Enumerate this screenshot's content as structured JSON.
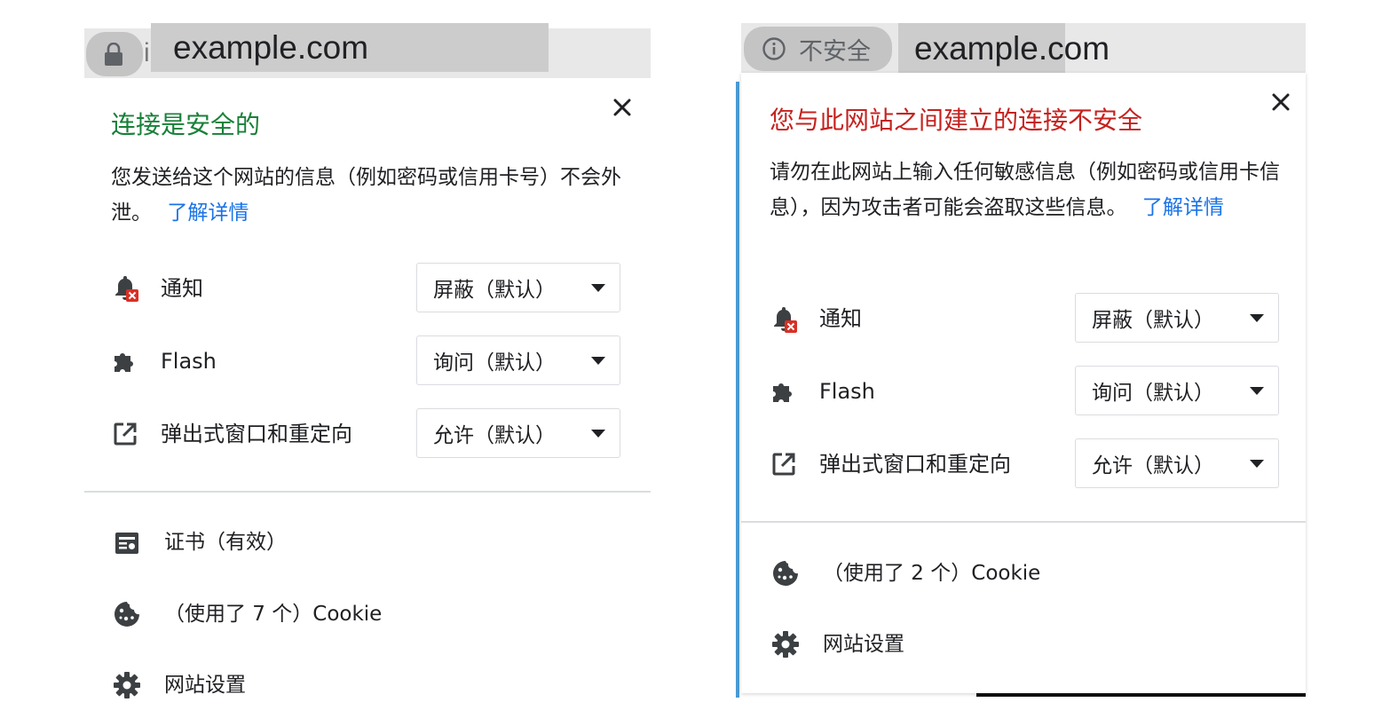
{
  "left": {
    "address_bar": {
      "url": "example.com",
      "partial_text": "i"
    },
    "title": "连接是安全的",
    "title_color": "#188038",
    "description": "您发送给这个网站的信息（例如密码或信用卡号）不会外泄。",
    "learn_more": "了解详情",
    "permissions": [
      {
        "icon": "notification-blocked-icon",
        "label": "通知",
        "value": "屏蔽（默认）"
      },
      {
        "icon": "puzzle-icon",
        "label": "Flash",
        "value": "询问（默认）"
      },
      {
        "icon": "popup-icon",
        "label": "弹出式窗口和重定向",
        "value": "允许（默认）"
      }
    ],
    "items": [
      {
        "icon": "certificate-icon",
        "label": "证书（有效）"
      },
      {
        "icon": "cookie-icon",
        "label": "（使用了 7 个）Cookie"
      },
      {
        "icon": "gear-icon",
        "label": "网站设置"
      }
    ]
  },
  "right": {
    "address_bar": {
      "url": "example.com",
      "security_label": "不安全"
    },
    "title": "您与此网站之间建立的连接不安全",
    "title_color": "#c5221f",
    "description": "请勿在此网站上输入任何敏感信息（例如密码或信用卡信息），因为攻击者可能会盗取这些信息。",
    "learn_more": "了解详情",
    "permissions": [
      {
        "icon": "notification-blocked-icon",
        "label": "通知",
        "value": "屏蔽（默认）"
      },
      {
        "icon": "puzzle-icon",
        "label": "Flash",
        "value": "询问（默认）"
      },
      {
        "icon": "popup-icon",
        "label": "弹出式窗口和重定向",
        "value": "允许（默认）"
      }
    ],
    "items": [
      {
        "icon": "cookie-icon",
        "label": "（使用了 2 个）Cookie"
      },
      {
        "icon": "gear-icon",
        "label": "网站设置"
      }
    ]
  },
  "colors": {
    "link": "#1a73e8",
    "icon": "#5f6368",
    "blocked_badge": "#d93025",
    "panel_border_accent": "#4a9ad4"
  }
}
